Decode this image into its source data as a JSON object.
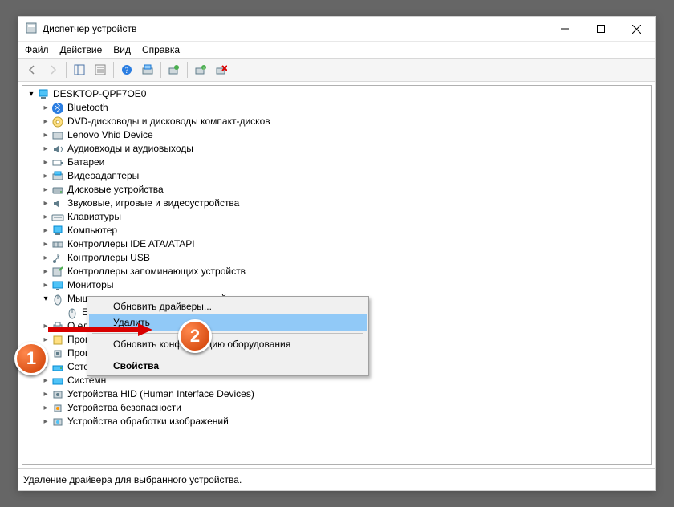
{
  "window": {
    "title": "Диспетчер устройств"
  },
  "menubar": [
    "Файл",
    "Действие",
    "Вид",
    "Справка"
  ],
  "tree": {
    "root": "DESKTOP-QPF7OE0",
    "nodes": [
      {
        "label": "Bluetooth",
        "icon": "bt"
      },
      {
        "label": "DVD-дисководы и дисководы компакт-дисков",
        "icon": "disc"
      },
      {
        "label": "Lenovo Vhid Device",
        "icon": "dev"
      },
      {
        "label": "Аудиовходы и аудиовыходы",
        "icon": "audio"
      },
      {
        "label": "Батареи",
        "icon": "bat"
      },
      {
        "label": "Видеоадаптеры",
        "icon": "gpu"
      },
      {
        "label": "Дисковые устройства",
        "icon": "disk"
      },
      {
        "label": "Звуковые, игровые и видеоустройства",
        "icon": "snd"
      },
      {
        "label": "Клавиатуры",
        "icon": "kb"
      },
      {
        "label": "Компьютер",
        "icon": "pc"
      },
      {
        "label": "Контроллеры IDE ATA/ATAPI",
        "icon": "ide"
      },
      {
        "label": "Контроллеры USB",
        "icon": "usb"
      },
      {
        "label": "Контроллеры запоминающих устройств",
        "icon": "stor"
      },
      {
        "label": "Мониторы",
        "icon": "mon"
      },
      {
        "label": "Мыши и иные указывающие устройства",
        "icon": "mouse",
        "expanded": true,
        "children": [
          {
            "label": "ELAN",
            "icon": "mouse",
            "selected": true
          }
        ]
      },
      {
        "label": "О    еди",
        "icon": "print",
        "partial": true
      },
      {
        "label": "Програм",
        "icon": "sw",
        "partial": true
      },
      {
        "label": "Процесс",
        "icon": "cpu",
        "partial": true
      },
      {
        "label": "Сетевые",
        "icon": "net",
        "partial": true
      },
      {
        "label": "Системн",
        "icon": "sys",
        "partial": true
      },
      {
        "label": "Устройства HID (Human Interface Devices)",
        "icon": "hid"
      },
      {
        "label": "Устройства безопасности",
        "icon": "sec"
      },
      {
        "label": "Устройства обработки изображений",
        "icon": "img"
      }
    ]
  },
  "context_menu": {
    "items": [
      {
        "label": "Обновить драйверы...",
        "type": "item"
      },
      {
        "label": "Удалить",
        "type": "item",
        "highlight": true
      },
      {
        "type": "sep"
      },
      {
        "label": "Обновить конфигурацию оборудования",
        "type": "item"
      },
      {
        "type": "sep"
      },
      {
        "label": "Свойства",
        "type": "item",
        "bold": true
      }
    ]
  },
  "status": "Удаление драйвера для выбранного устройства.",
  "annotations": {
    "badge1": "1",
    "badge2": "2"
  }
}
